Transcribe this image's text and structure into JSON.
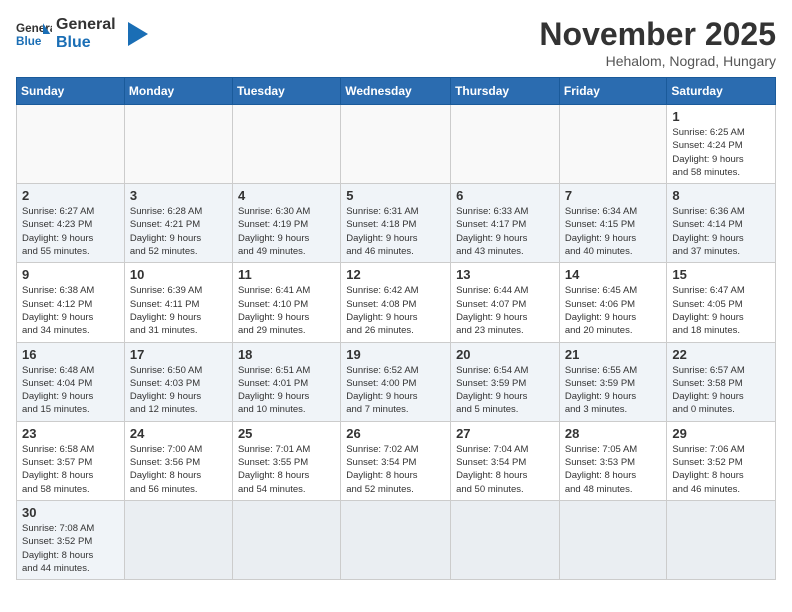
{
  "logo": {
    "general": "General",
    "blue": "Blue"
  },
  "title": {
    "month_year": "November 2025",
    "location": "Hehalom, Nograd, Hungary"
  },
  "weekdays": [
    "Sunday",
    "Monday",
    "Tuesday",
    "Wednesday",
    "Thursday",
    "Friday",
    "Saturday"
  ],
  "weeks": [
    [
      {
        "day": "",
        "info": ""
      },
      {
        "day": "",
        "info": ""
      },
      {
        "day": "",
        "info": ""
      },
      {
        "day": "",
        "info": ""
      },
      {
        "day": "",
        "info": ""
      },
      {
        "day": "",
        "info": ""
      },
      {
        "day": "1",
        "info": "Sunrise: 6:25 AM\nSunset: 4:24 PM\nDaylight: 9 hours\nand 58 minutes."
      }
    ],
    [
      {
        "day": "2",
        "info": "Sunrise: 6:27 AM\nSunset: 4:23 PM\nDaylight: 9 hours\nand 55 minutes."
      },
      {
        "day": "3",
        "info": "Sunrise: 6:28 AM\nSunset: 4:21 PM\nDaylight: 9 hours\nand 52 minutes."
      },
      {
        "day": "4",
        "info": "Sunrise: 6:30 AM\nSunset: 4:19 PM\nDaylight: 9 hours\nand 49 minutes."
      },
      {
        "day": "5",
        "info": "Sunrise: 6:31 AM\nSunset: 4:18 PM\nDaylight: 9 hours\nand 46 minutes."
      },
      {
        "day": "6",
        "info": "Sunrise: 6:33 AM\nSunset: 4:17 PM\nDaylight: 9 hours\nand 43 minutes."
      },
      {
        "day": "7",
        "info": "Sunrise: 6:34 AM\nSunset: 4:15 PM\nDaylight: 9 hours\nand 40 minutes."
      },
      {
        "day": "8",
        "info": "Sunrise: 6:36 AM\nSunset: 4:14 PM\nDaylight: 9 hours\nand 37 minutes."
      }
    ],
    [
      {
        "day": "9",
        "info": "Sunrise: 6:38 AM\nSunset: 4:12 PM\nDaylight: 9 hours\nand 34 minutes."
      },
      {
        "day": "10",
        "info": "Sunrise: 6:39 AM\nSunset: 4:11 PM\nDaylight: 9 hours\nand 31 minutes."
      },
      {
        "day": "11",
        "info": "Sunrise: 6:41 AM\nSunset: 4:10 PM\nDaylight: 9 hours\nand 29 minutes."
      },
      {
        "day": "12",
        "info": "Sunrise: 6:42 AM\nSunset: 4:08 PM\nDaylight: 9 hours\nand 26 minutes."
      },
      {
        "day": "13",
        "info": "Sunrise: 6:44 AM\nSunset: 4:07 PM\nDaylight: 9 hours\nand 23 minutes."
      },
      {
        "day": "14",
        "info": "Sunrise: 6:45 AM\nSunset: 4:06 PM\nDaylight: 9 hours\nand 20 minutes."
      },
      {
        "day": "15",
        "info": "Sunrise: 6:47 AM\nSunset: 4:05 PM\nDaylight: 9 hours\nand 18 minutes."
      }
    ],
    [
      {
        "day": "16",
        "info": "Sunrise: 6:48 AM\nSunset: 4:04 PM\nDaylight: 9 hours\nand 15 minutes."
      },
      {
        "day": "17",
        "info": "Sunrise: 6:50 AM\nSunset: 4:03 PM\nDaylight: 9 hours\nand 12 minutes."
      },
      {
        "day": "18",
        "info": "Sunrise: 6:51 AM\nSunset: 4:01 PM\nDaylight: 9 hours\nand 10 minutes."
      },
      {
        "day": "19",
        "info": "Sunrise: 6:52 AM\nSunset: 4:00 PM\nDaylight: 9 hours\nand 7 minutes."
      },
      {
        "day": "20",
        "info": "Sunrise: 6:54 AM\nSunset: 3:59 PM\nDaylight: 9 hours\nand 5 minutes."
      },
      {
        "day": "21",
        "info": "Sunrise: 6:55 AM\nSunset: 3:59 PM\nDaylight: 9 hours\nand 3 minutes."
      },
      {
        "day": "22",
        "info": "Sunrise: 6:57 AM\nSunset: 3:58 PM\nDaylight: 9 hours\nand 0 minutes."
      }
    ],
    [
      {
        "day": "23",
        "info": "Sunrise: 6:58 AM\nSunset: 3:57 PM\nDaylight: 8 hours\nand 58 minutes."
      },
      {
        "day": "24",
        "info": "Sunrise: 7:00 AM\nSunset: 3:56 PM\nDaylight: 8 hours\nand 56 minutes."
      },
      {
        "day": "25",
        "info": "Sunrise: 7:01 AM\nSunset: 3:55 PM\nDaylight: 8 hours\nand 54 minutes."
      },
      {
        "day": "26",
        "info": "Sunrise: 7:02 AM\nSunset: 3:54 PM\nDaylight: 8 hours\nand 52 minutes."
      },
      {
        "day": "27",
        "info": "Sunrise: 7:04 AM\nSunset: 3:54 PM\nDaylight: 8 hours\nand 50 minutes."
      },
      {
        "day": "28",
        "info": "Sunrise: 7:05 AM\nSunset: 3:53 PM\nDaylight: 8 hours\nand 48 minutes."
      },
      {
        "day": "29",
        "info": "Sunrise: 7:06 AM\nSunset: 3:52 PM\nDaylight: 8 hours\nand 46 minutes."
      }
    ],
    [
      {
        "day": "30",
        "info": "Sunrise: 7:08 AM\nSunset: 3:52 PM\nDaylight: 8 hours\nand 44 minutes."
      },
      {
        "day": "",
        "info": ""
      },
      {
        "day": "",
        "info": ""
      },
      {
        "day": "",
        "info": ""
      },
      {
        "day": "",
        "info": ""
      },
      {
        "day": "",
        "info": ""
      },
      {
        "day": "",
        "info": ""
      }
    ]
  ]
}
